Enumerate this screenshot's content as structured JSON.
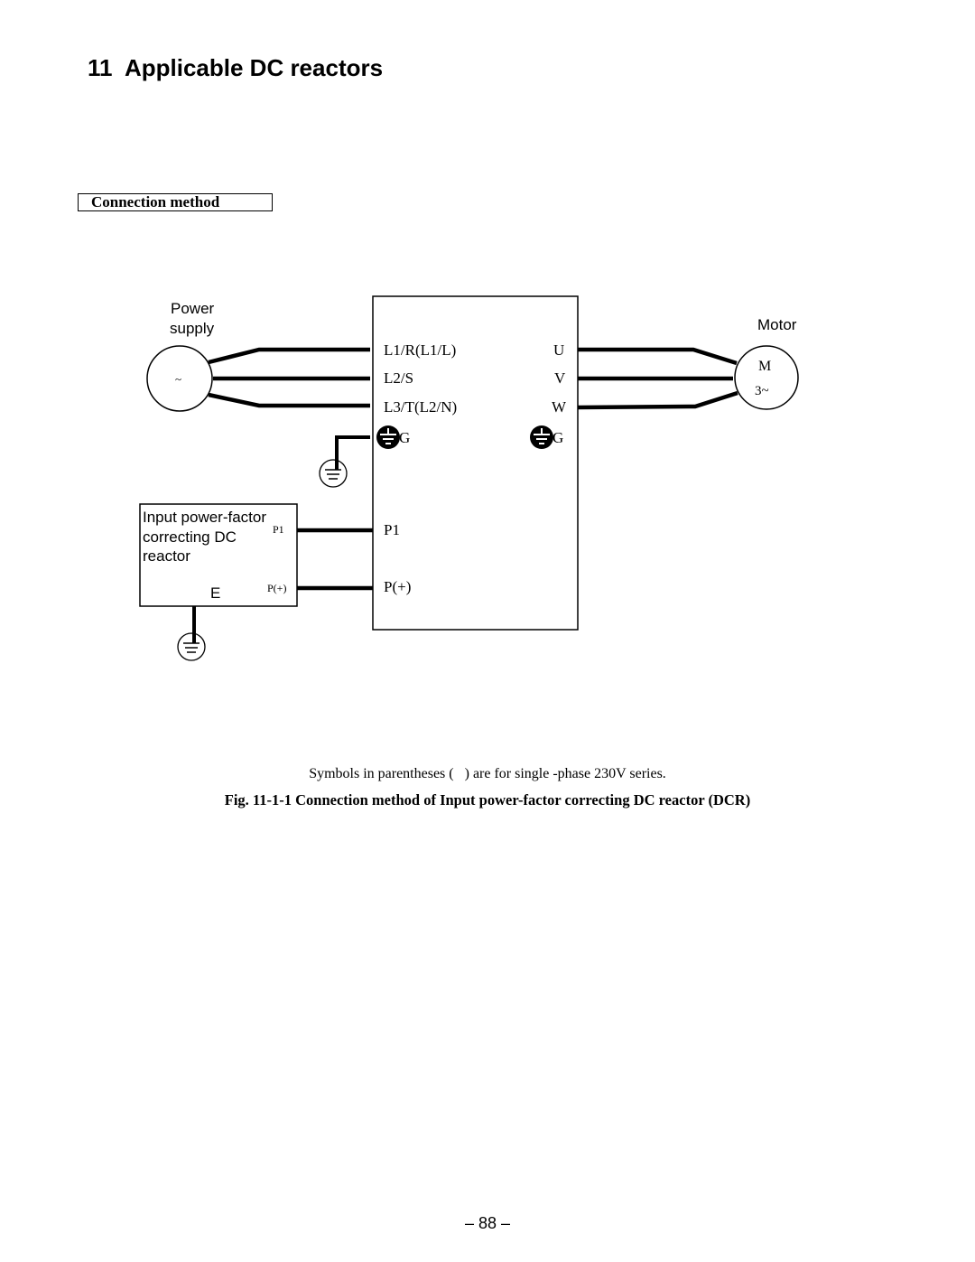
{
  "page": {
    "heading": "11  Applicable DC reactors",
    "section_label": "Connection method",
    "page_number": "– 88 –"
  },
  "diagram": {
    "power_supply": {
      "label_line1": "Power",
      "label_line2": "supply",
      "symbol": "~"
    },
    "motor": {
      "label": "Motor",
      "symbol_line1": "M",
      "symbol_line2": "3~"
    },
    "inverter": {
      "input_terminals": [
        "L1/R(L1/L)",
        "L2/S",
        "L3/T(L2/N)"
      ],
      "output_terminals": [
        "U",
        "V",
        "W"
      ],
      "ground_label_left": "G",
      "ground_label_right": "G",
      "dc_terminals": [
        "P1",
        "P(+)"
      ]
    },
    "reactor": {
      "label_line1": "Input power-factor",
      "label_line2": "correcting DC",
      "label_line3": "reactor",
      "ground_terminal": "E",
      "terminals": [
        "P1",
        "P(+)"
      ]
    },
    "icons": {
      "power_source": "ac-source-circle",
      "motor": "motor-circle",
      "ground": "earth-ground-symbol",
      "protective_ground": "filled-ground-terminal"
    }
  },
  "notes": {
    "parentheses_note": "Symbols in parentheses (   ) are for single -phase 230V series.",
    "figure_caption": "Fig. 11-1-1 Connection method of Input power-factor correcting DC reactor (DCR)"
  }
}
